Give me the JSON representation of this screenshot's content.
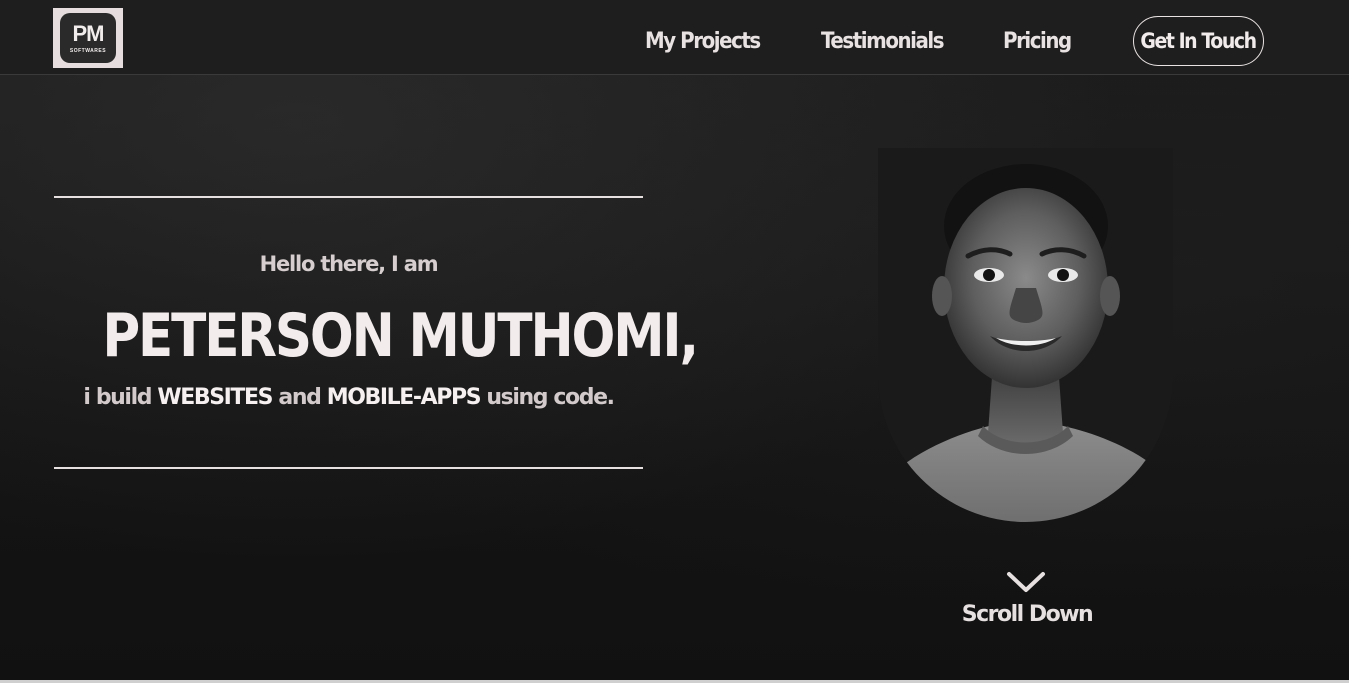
{
  "header": {
    "logo": {
      "main": "PM",
      "sub": "SOFTWARES"
    },
    "nav": {
      "projects": "My Projects",
      "testimonials": "Testimonials",
      "pricing": "Pricing",
      "contact": "Get In Touch"
    }
  },
  "hero": {
    "greeting": "Hello there, I am",
    "name": "PETERSON MUTHOMI,",
    "tagline": {
      "prefix": "i build",
      "websites": "WEBSITES",
      "and": "and",
      "apps": "MOBILE-APPS",
      "suffix": "using code."
    }
  },
  "scroll": {
    "label": "Scroll Down",
    "icon": "chevron-down-icon"
  },
  "colors": {
    "background": "#141414",
    "header_bg": "#1e1e1e",
    "text_primary": "#f3ecec",
    "accent_light": "#e6dede"
  }
}
